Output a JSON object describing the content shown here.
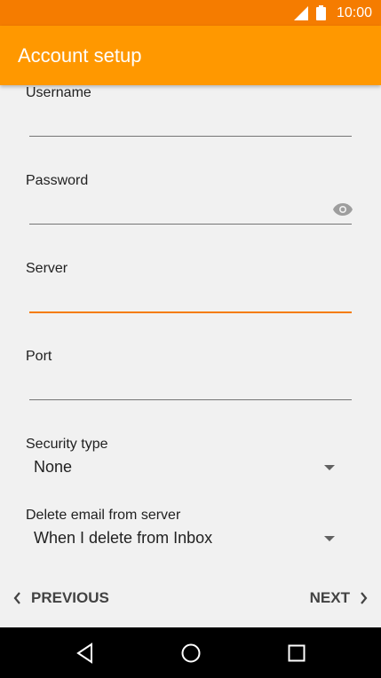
{
  "status_bar": {
    "time": "10:00"
  },
  "app_bar": {
    "title": "Account setup"
  },
  "form": {
    "username": {
      "label": "Username",
      "value": ""
    },
    "password": {
      "label": "Password",
      "value": ""
    },
    "server": {
      "label": "Server",
      "value": ""
    },
    "port": {
      "label": "Port",
      "value": ""
    },
    "security_type": {
      "label": "Security type",
      "value": "None"
    },
    "delete_email": {
      "label": "Delete email from server",
      "value": "When I delete from Inbox"
    }
  },
  "buttons": {
    "previous": "PREVIOUS",
    "next": "NEXT"
  },
  "colors": {
    "status_bar": "#f57c00",
    "app_bar": "#ff9800",
    "accent": "#f57c00"
  },
  "icons": [
    "signal-icon",
    "battery-icon",
    "eye-icon",
    "chevron-left-icon",
    "chevron-right-icon",
    "back-icon",
    "home-icon",
    "recents-icon"
  ]
}
